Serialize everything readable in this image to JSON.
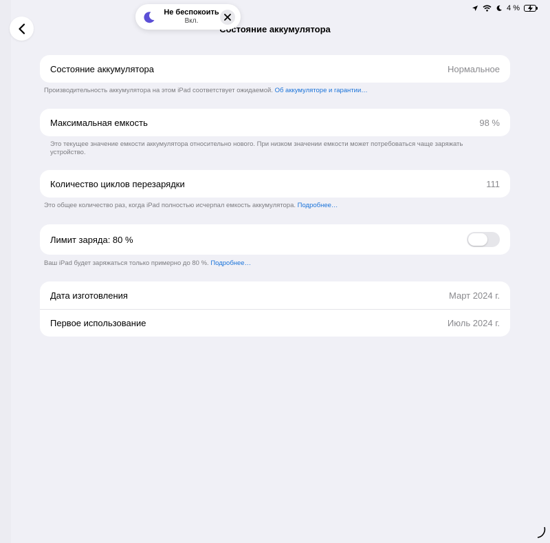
{
  "status_bar": {
    "battery_percent": "4 %",
    "battery_level": 0.04
  },
  "dnd": {
    "title": "Не беспокоить",
    "subtitle": "Вкл."
  },
  "page": {
    "title": "Состояние аккумулятора"
  },
  "health": {
    "label": "Состояние аккумулятора",
    "value": "Нормальное",
    "footnote": "Производительность аккумулятора на этом iPad соответствует ожидаемой.",
    "link": "Об аккумуляторе и гарантии…"
  },
  "capacity": {
    "label": "Максимальная емкость",
    "value": "98 %",
    "footnote": "Это текущее значение емкости аккумулятора относительно нового. При низком значении емкости может потребоваться чаще заряжать устройство."
  },
  "cycles": {
    "label": "Количество циклов перезарядки",
    "value": "111",
    "footnote": "Это общее количество раз, когда iPad полностью исчерпал емкость аккумулятора.",
    "link": "Подробнее…"
  },
  "limit": {
    "label": "Лимит заряда: 80 %",
    "toggle_on": false,
    "footnote": "Ваш iPad будет заряжаться только примерно до 80 %.",
    "link": "Подробнее…"
  },
  "dates": {
    "manufactured_label": "Дата изготовления",
    "manufactured_value": "Март 2024 г.",
    "first_use_label": "Первое использование",
    "first_use_value": "Июль 2024 г."
  },
  "colors": {
    "accent": "#1a73d9",
    "background": "#f0f0f6",
    "moon": "#5b4fd6"
  }
}
